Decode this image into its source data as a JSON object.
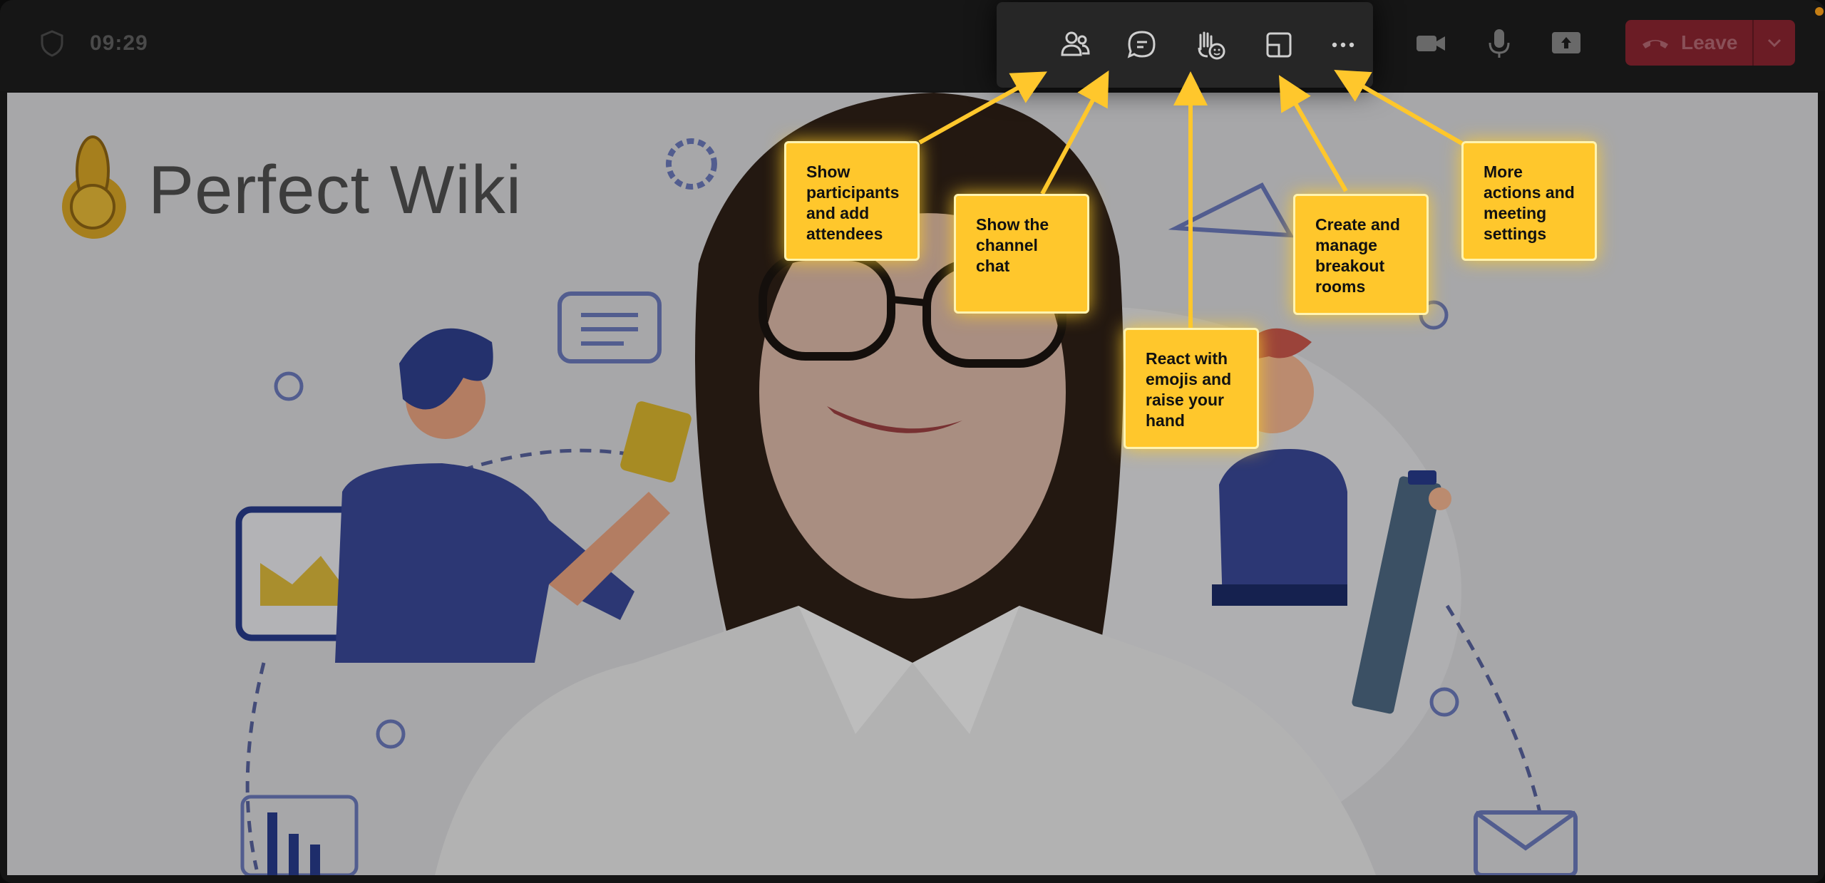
{
  "meeting": {
    "time": "09:29",
    "leave_label": "Leave",
    "leave_color": "#6b1c25"
  },
  "toolbar": {
    "buttons": [
      {
        "icon": "people-icon",
        "label": "Participants"
      },
      {
        "icon": "chat-icon",
        "label": "Chat"
      },
      {
        "icon": "react-raise-hand-icon",
        "label": "React"
      },
      {
        "icon": "breakout-rooms-icon",
        "label": "Rooms"
      },
      {
        "icon": "more-icon",
        "label": "More"
      }
    ]
  },
  "media": {
    "camera_icon": "camera-icon",
    "mic_icon": "microphone-icon",
    "share_icon": "share-screen-icon"
  },
  "background": {
    "brand": "Perfect Wiki"
  },
  "callouts": [
    {
      "id": "participants",
      "text": "Show participants and add attendees"
    },
    {
      "id": "chat",
      "text": "Show the channel chat"
    },
    {
      "id": "react",
      "text": "React with emojis and raise your hand"
    },
    {
      "id": "breakout",
      "text": "Create and manage breakout rooms"
    },
    {
      "id": "more",
      "text": "More actions and meeting settings"
    }
  ],
  "colors": {
    "callout": "#ffc72c",
    "toolbar": "#262626",
    "topbar": "#161616"
  }
}
